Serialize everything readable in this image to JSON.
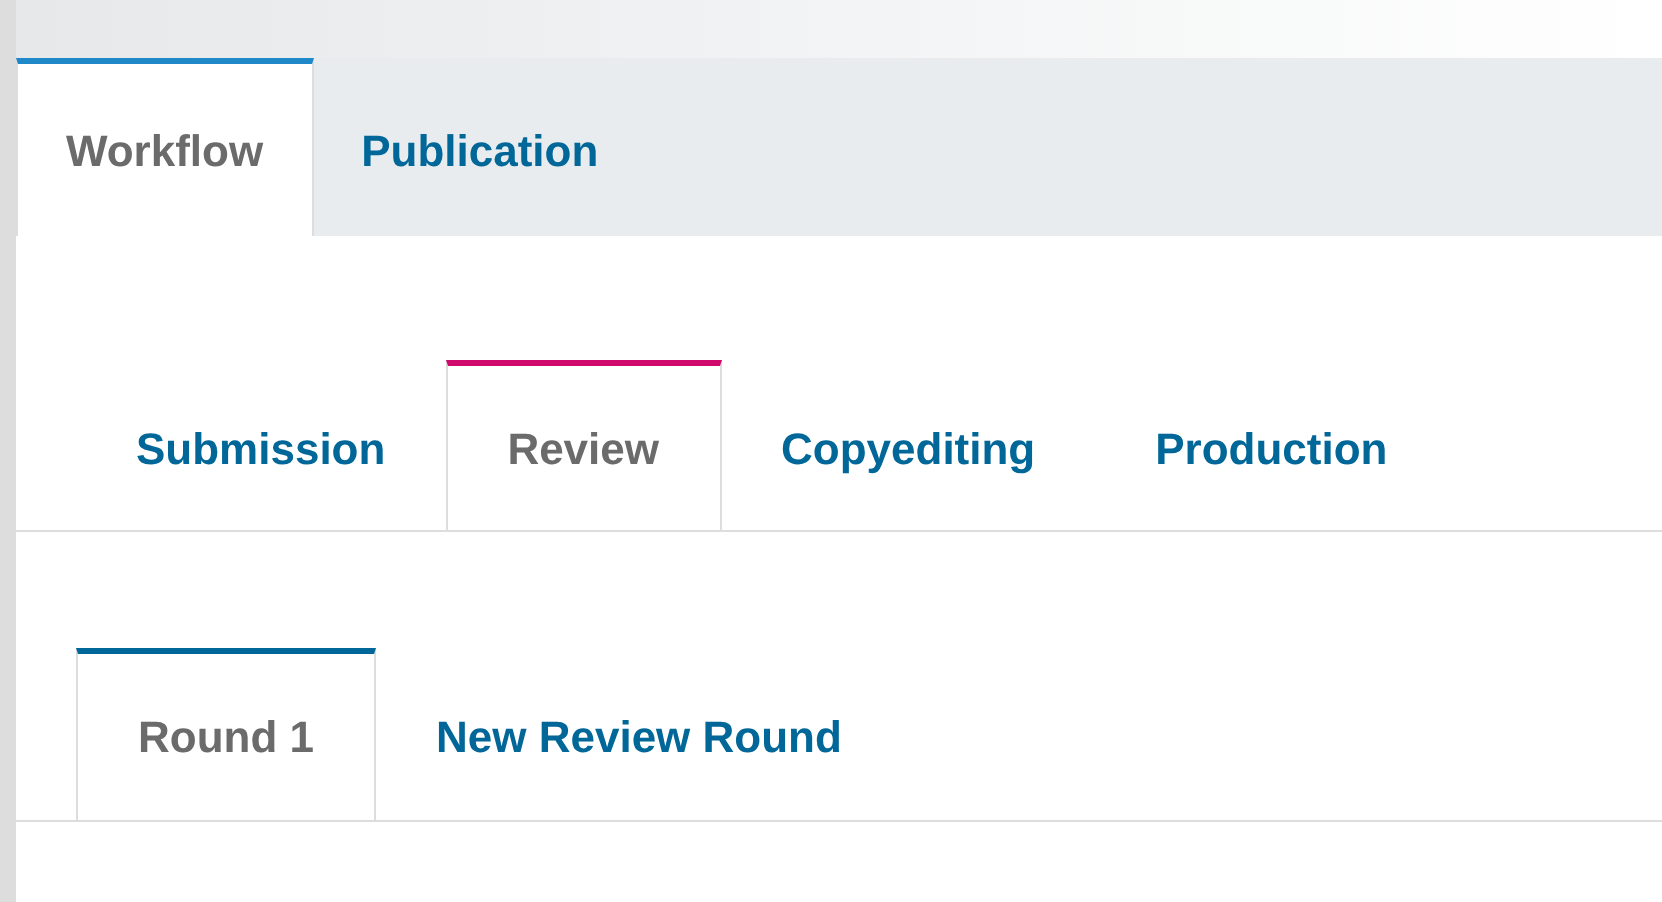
{
  "main_tabs": [
    {
      "label": "Workflow",
      "selected": true
    },
    {
      "label": "Publication",
      "selected": false
    }
  ],
  "stage_tabs": [
    {
      "label": "Submission",
      "selected": false
    },
    {
      "label": "Review",
      "selected": true
    },
    {
      "label": "Copyediting",
      "selected": false
    },
    {
      "label": "Production",
      "selected": false
    }
  ],
  "round_tabs": [
    {
      "label": "Round 1",
      "selected": true
    },
    {
      "label": "New Review Round",
      "selected": false
    }
  ]
}
